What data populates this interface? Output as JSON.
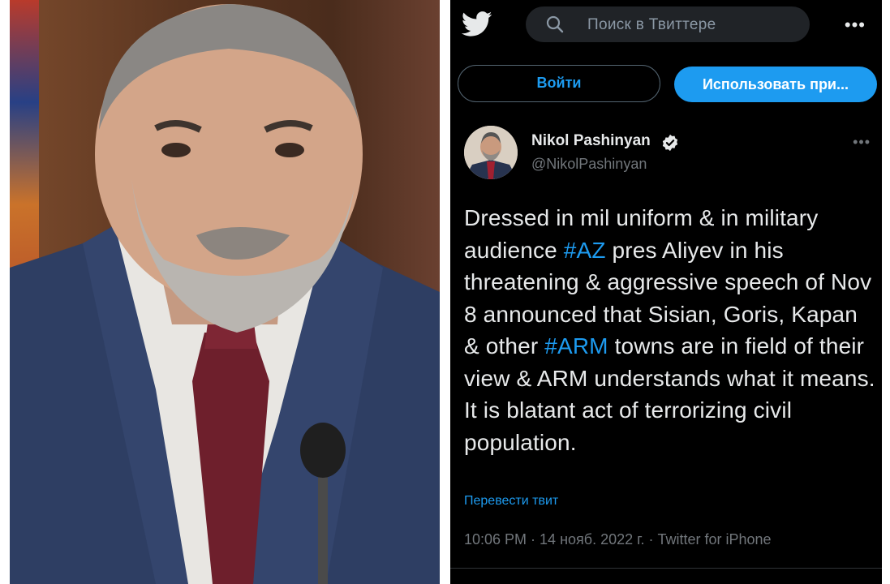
{
  "twitter": {
    "search_placeholder": "Поиск в Твиттере",
    "more_menu": "•••",
    "login_button": "Войти",
    "use_app_button": "Использовать при...",
    "author_name": "Nikol Pashinyan",
    "author_handle": "@NikolPashinyan",
    "post_menu": "•••",
    "tweet": {
      "p1": "Dressed in mil uniform & in military audience ",
      "tag1": "#AZ",
      "p2": " pres Aliyev in his threatening & aggressive speech of Nov 8 announced that Sisian, Goris, Kapan & other ",
      "tag2": "#ARM",
      "p3": " towns are in field of their view & ARM understands what it means. It is blatant act of terrorizing civil population."
    },
    "translate_link": "Перевести твит",
    "meta": "10:06 PM · 14 нояб. 2022 г. · Twitter for iPhone"
  },
  "colors": {
    "background": "#000000",
    "accent": "#1d9bf0",
    "text": "#e7e9ea",
    "muted": "#71767b"
  },
  "icons": [
    "twitter-bird-icon",
    "search-icon",
    "more-icon",
    "verified-badge-icon"
  ]
}
